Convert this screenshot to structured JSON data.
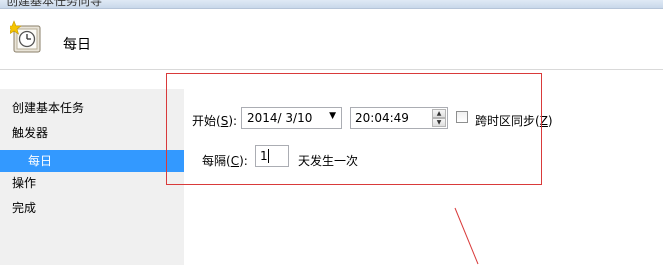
{
  "window": {
    "title": "创建基本任务向导"
  },
  "header": {
    "title": "每日",
    "icon": "clock-icon"
  },
  "sidebar": {
    "steps": [
      {
        "label": "创建基本任务"
      },
      {
        "label": "触发器"
      },
      {
        "label": "每日"
      },
      {
        "label": "操作"
      },
      {
        "label": "完成"
      }
    ]
  },
  "form": {
    "start_label": "开始(",
    "start_key": "S",
    "start_label_end": "):",
    "date_value": "2014/  3/10",
    "time_value": "20:04:49",
    "sync_label": "跨时区同步(",
    "sync_key": "Z",
    "sync_label_end": ")",
    "interval_label": "每隔(",
    "interval_key": "C",
    "interval_label_end": "):",
    "interval_value": "1",
    "interval_suffix": "天发生一次"
  },
  "colors": {
    "highlight": "#3399ff",
    "annotation": "#d93a3a",
    "sidebar_bg": "#f0f0f0"
  }
}
